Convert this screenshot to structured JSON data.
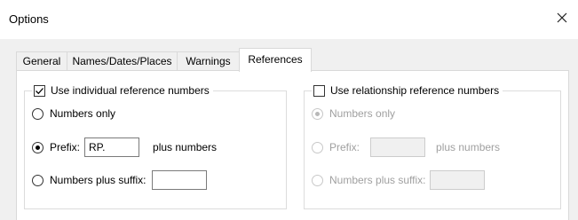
{
  "window": {
    "title": "Options"
  },
  "tabs": [
    {
      "label": "General"
    },
    {
      "label": "Names/Dates/Places"
    },
    {
      "label": "Warnings"
    },
    {
      "label": "References"
    }
  ],
  "individual": {
    "checkbox_label": "Use individual reference numbers",
    "checked": true,
    "opt_numbers_only": "Numbers only",
    "opt_prefix": "Prefix:",
    "prefix_value": "RP.",
    "plus_numbers": "plus numbers",
    "opt_suffix": "Numbers plus suffix:",
    "suffix_value": "",
    "selected": "prefix"
  },
  "relationship": {
    "checkbox_label": "Use relationship reference numbers",
    "checked": false,
    "opt_numbers_only": "Numbers only",
    "opt_prefix": "Prefix:",
    "prefix_value": "",
    "plus_numbers": "plus numbers",
    "opt_suffix": "Numbers plus suffix:",
    "suffix_value": "",
    "selected": "numbers_only"
  }
}
